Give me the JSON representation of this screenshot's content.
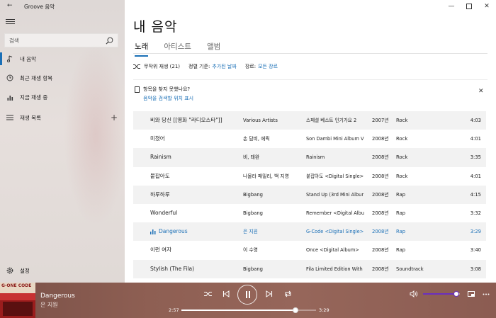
{
  "app": {
    "title": "Groove 음악"
  },
  "sidebar": {
    "search_placeholder": "검색",
    "items": [
      {
        "label": "내 음악",
        "icon": "music-note-icon"
      },
      {
        "label": "최근 재생 항목",
        "icon": "clock-icon"
      },
      {
        "label": "지금 재생 중",
        "icon": "bar-chart-icon"
      },
      {
        "label": "재생 목록",
        "icon": "playlist-icon"
      }
    ],
    "settings_label": "설정"
  },
  "main": {
    "title": "내 음악",
    "tabs": [
      {
        "label": "노래",
        "active": true
      },
      {
        "label": "아티스트",
        "active": false
      },
      {
        "label": "앨범",
        "active": false
      }
    ],
    "filters": {
      "shuffle_label": "무작위 재생 (21)",
      "sort_label": "정렬 기준:",
      "sort_value": "추가된 날짜",
      "genre_label": "장르:",
      "genre_value": "모든 장르"
    },
    "hint": {
      "question": "항목을 찾지 못했나요?",
      "link": "음악을 검색할 위치 표시"
    }
  },
  "songs": [
    {
      "title": "비와 당신 [[영화 \"라디오스타\"]]",
      "artist": "Various Artists",
      "album": "스페셜 베스트 인기가요 2",
      "year": "2007년",
      "genre": "Rock",
      "duration": "4:03"
    },
    {
      "title": "미쳤어",
      "artist": "손 담비, 에릭",
      "album": "Son Dambi Mini Album V",
      "year": "2008년",
      "genre": "Rock",
      "duration": "4:01"
    },
    {
      "title": "Rainism",
      "artist": "비, 태완",
      "album": "Rainism",
      "year": "2008년",
      "genre": "Rock",
      "duration": "3:35"
    },
    {
      "title": "붙잡아도",
      "artist": "나몰라 패밀리, 백 지영",
      "album": "붙잡아도 <Digital Single>",
      "year": "2008년",
      "genre": "Rock",
      "duration": "4:01"
    },
    {
      "title": "하루하루",
      "artist": "Bigbang",
      "album": "Stand Up (3rd Mini Albur",
      "year": "2008년",
      "genre": "Rap",
      "duration": "4:15"
    },
    {
      "title": "Wonderful",
      "artist": "Bigbang",
      "album": "Remember <Digital Albu",
      "year": "2008년",
      "genre": "Rap",
      "duration": "3:32"
    },
    {
      "title": "Dangerous",
      "artist": "은 지원",
      "album": "G-Code <Digital Single>",
      "year": "2008년",
      "genre": "Rap",
      "duration": "3:29",
      "playing": true
    },
    {
      "title": "이런 여자",
      "artist": "이 수영",
      "album": "Once <Digital Album>",
      "year": "2008년",
      "genre": "Rap",
      "duration": "3:40"
    },
    {
      "title": "Stylish (The Fila)",
      "artist": "Bigbang",
      "album": "Fila Limited Edition With",
      "year": "2008년",
      "genre": "Soundtrack",
      "duration": "3:08"
    }
  ],
  "now_playing": {
    "title": "Dangerous",
    "artist": "은 지원",
    "cover_text": "G-ONE CODE",
    "current_time": "2:57",
    "total_time": "3:29",
    "progress": 0.8469,
    "volume": 0.9
  },
  "colors": {
    "accent": "#1a6fb6",
    "player_bg": "#8e5f53",
    "volume_accent": "#6b2fbf"
  }
}
